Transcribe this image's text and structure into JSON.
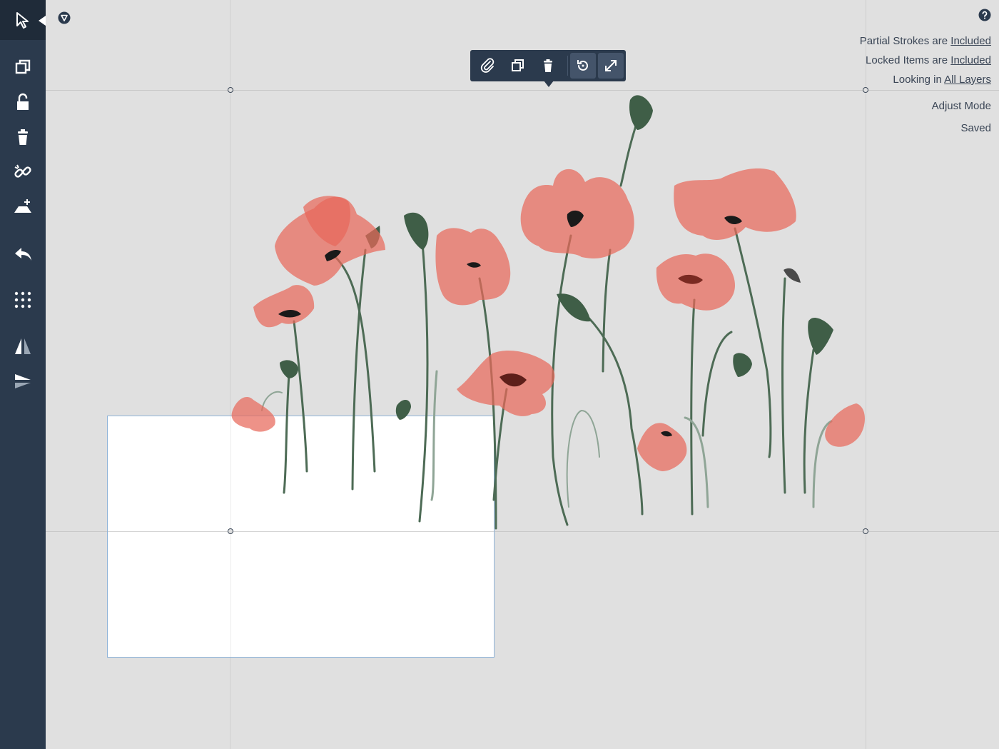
{
  "sidebar": {
    "tools": [
      {
        "name": "select-icon"
      },
      {
        "name": "duplicate-icon"
      },
      {
        "name": "lock-icon"
      },
      {
        "name": "trash-icon"
      },
      {
        "name": "unlink-icon"
      },
      {
        "name": "add-layer-icon"
      },
      {
        "name": "undo-icon"
      },
      {
        "name": "grid-icon"
      },
      {
        "name": "flip-horizontal-icon"
      },
      {
        "name": "flip-vertical-icon"
      }
    ]
  },
  "toolbar": {
    "items": [
      "paperclip-icon",
      "duplicate-icon",
      "trash-icon",
      "rotate-icon",
      "expand-icon"
    ]
  },
  "status": {
    "partial_prefix": "Partial Strokes are",
    "partial_value": "Included",
    "locked_prefix": "Locked Items are",
    "locked_value": "Included",
    "looking_prefix": "Looking in",
    "looking_value": "All Layers",
    "mode": "Adjust Mode",
    "saved": "Saved"
  },
  "colors": {
    "sidebar": "#2b3a4d",
    "canvas": "#e0e0e0",
    "petal": "#e8685a",
    "stem": "#4d6b55",
    "selection_border": "#8eb3d8"
  }
}
